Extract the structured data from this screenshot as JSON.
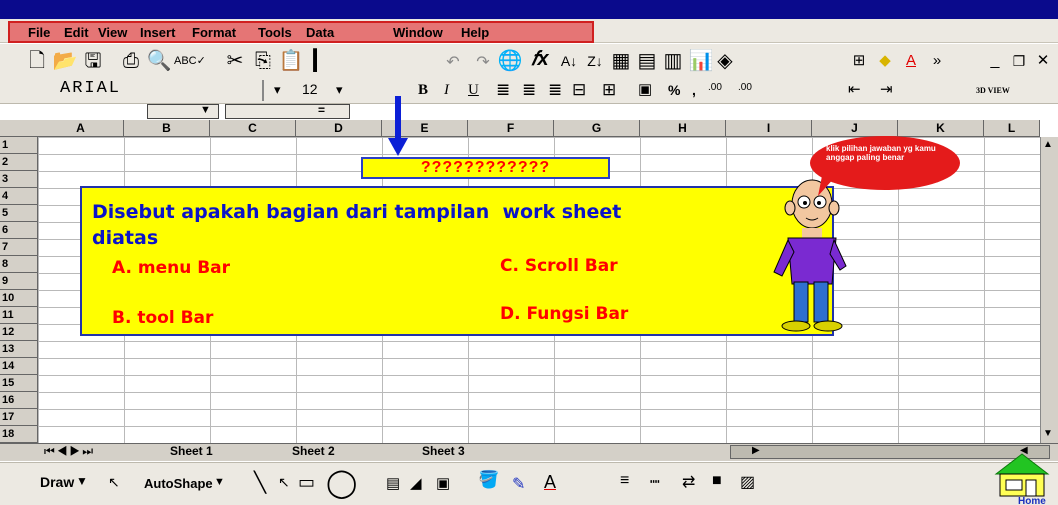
{
  "menu": {
    "items": [
      "File",
      "Edit",
      "View",
      "Insert",
      "Format",
      "Tools",
      "Data",
      "Window",
      "Help"
    ]
  },
  "formatting": {
    "font_name": "ARIAL",
    "font_size": "12",
    "view_label": "3D VIEW"
  },
  "columns": [
    "A",
    "B",
    "C",
    "D",
    "E",
    "F",
    "G",
    "H",
    "I",
    "J",
    "K",
    "L"
  ],
  "rows": [
    "1",
    "2",
    "3",
    "4",
    "5",
    "6",
    "7",
    "8",
    "9",
    "10",
    "11",
    "12",
    "13",
    "14",
    "15",
    "16",
    "17",
    "18"
  ],
  "sheets": [
    "Sheet 1",
    "Sheet 2",
    "Sheet 3"
  ],
  "drawbar": {
    "draw_label": "Draw",
    "autoshape_label": "AutoShape",
    "font_color_letter": "A"
  },
  "quiz": {
    "question_mark_text": "????????????",
    "question_line1": "Disebut apakah bagian dari tampilan  work sheet",
    "question_line2": "diatas",
    "answer_a": "A. menu Bar",
    "answer_b": "B. tool Bar",
    "answer_c": "C. Scroll Bar",
    "answer_d": "D. Fungsi Bar",
    "bubble_text": "klik pilihan jawaban yg kamu anggap paling benar"
  },
  "home_label": "Home",
  "colors": {
    "panel_yellow": "#ffff00",
    "question_blue": "#0b14c8",
    "answer_red": "#ff0000",
    "menu_highlight": "#e57575",
    "title_blue": "#0a0a8c"
  }
}
